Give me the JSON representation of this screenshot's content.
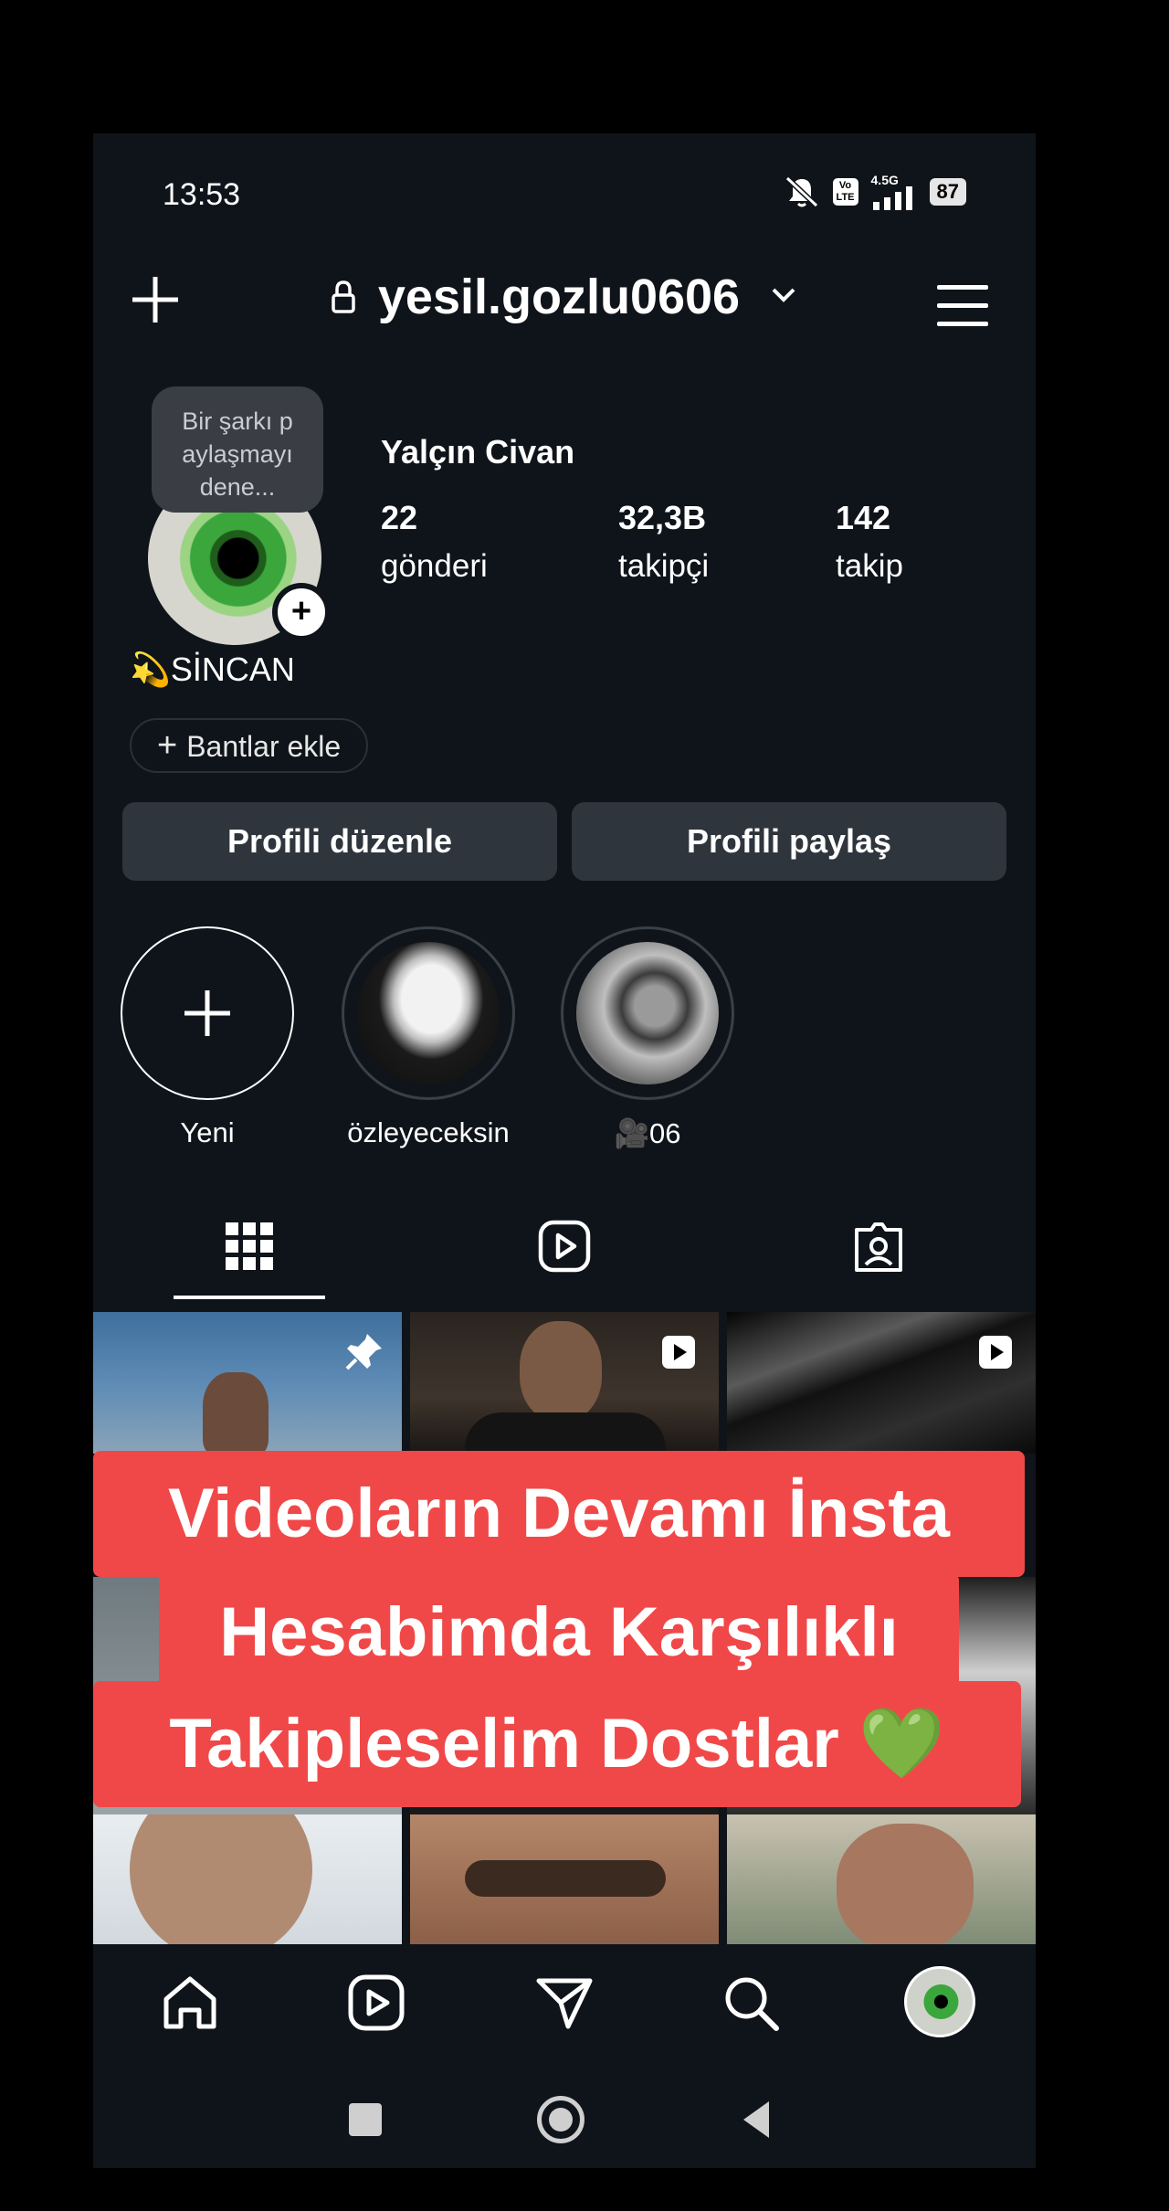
{
  "status_bar": {
    "time": "13:53",
    "network": "4.5G",
    "battery": "87",
    "icons": [
      "mute-icon",
      "volte-icon",
      "signal-icon",
      "battery-icon"
    ]
  },
  "header": {
    "username": "yesil.gozlu0606",
    "icons": [
      "plus-icon",
      "lock-icon",
      "chevron-down-icon",
      "menu-icon"
    ]
  },
  "profile": {
    "tooltip": "Bir şarkı paylaşmayı dene...",
    "tooltip_lines": [
      "Bir şarkı p",
      "aylaşmayı",
      "dene..."
    ],
    "full_name": "Yalçın Civan",
    "stats": [
      {
        "value": "22",
        "label": "gönderi"
      },
      {
        "value": "32,3B",
        "label": "takipçi"
      },
      {
        "value": "142",
        "label": "takip"
      }
    ],
    "bio": "💫SİNCAN",
    "bands_label": "Bantlar ekle",
    "edit_label": "Profili düzenle",
    "share_label": "Profili paylaş"
  },
  "highlights": [
    {
      "label": "Yeni"
    },
    {
      "label": "özleyeceksin"
    },
    {
      "label": "🎥06"
    }
  ],
  "tabs": [
    "grid-icon",
    "reels-icon",
    "tagged-icon"
  ],
  "banner": {
    "lines": [
      "Videoların Devamı İnsta",
      "Hesabimda Karşılıklı",
      "Takipleselim Dostlar 💚"
    ]
  },
  "bottom_nav": [
    "home-icon",
    "reels-icon",
    "send-icon",
    "search-icon",
    "profile-avatar"
  ],
  "colors": {
    "background": "#0f141a",
    "button": "#2f353c",
    "banner": "#f04848",
    "accent_green": "#3aa63c"
  }
}
